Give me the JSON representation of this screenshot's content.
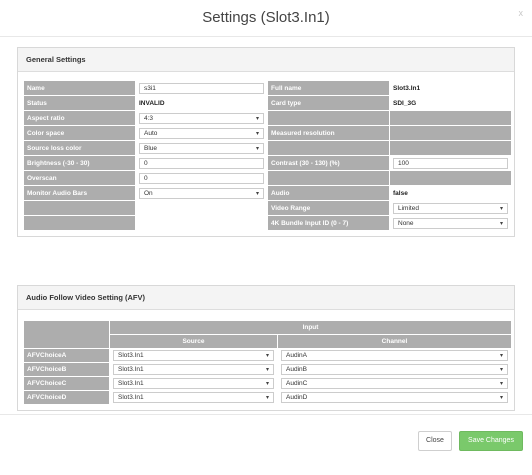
{
  "dialog": {
    "title": "Settings (Slot3.In1)",
    "close_glyph": "x"
  },
  "general": {
    "heading": "General Settings",
    "rows": [
      {
        "label": "Name",
        "value": "s3i1",
        "type": "input",
        "label2": "Full name",
        "value2": "Slot3.In1",
        "type2": "text"
      },
      {
        "label": "Status",
        "value": "INVALID",
        "type": "text",
        "label2": "Card type",
        "value2": "SDI_3G",
        "type2": "text"
      },
      {
        "label": "Aspect ratio",
        "value": "4:3",
        "type": "select",
        "label2": "",
        "value2": "",
        "type2": "none"
      },
      {
        "label": "Color space",
        "value": "Auto",
        "type": "select",
        "label2": "Measured resolution",
        "value2": "",
        "type2": "none"
      },
      {
        "label": "Source loss color",
        "value": "Blue",
        "type": "select",
        "label2": "",
        "value2": "",
        "type2": "none"
      },
      {
        "label": "Brightness (-30 - 30)",
        "value": "0",
        "type": "input",
        "label2": "Contrast (30 - 130) (%)",
        "value2": "100",
        "type2": "input"
      },
      {
        "label": "Overscan",
        "value": "0",
        "type": "input",
        "label2": "",
        "value2": "",
        "type2": "none"
      },
      {
        "label": "Monitor Audio Bars",
        "value": "On",
        "type": "select",
        "label2": "Audio",
        "value2": "false",
        "type2": "text"
      },
      {
        "label": "",
        "value": "",
        "type": "none",
        "label2": "Video Range",
        "value2": "Limited",
        "type2": "select"
      },
      {
        "label": "",
        "value": "",
        "type": "none",
        "label2": "4K Bundle Input ID (0 - 7)",
        "value2": "None",
        "type2": "select"
      }
    ]
  },
  "afv": {
    "heading": "Audio Follow Video Setting (AFV)",
    "input_header": "Input",
    "source_header": "Source",
    "channel_header": "Channel",
    "rows": [
      {
        "label": "AFVChoiceA",
        "source": "Slot3.In1",
        "channel": "AudinA"
      },
      {
        "label": "AFVChoiceB",
        "source": "Slot3.In1",
        "channel": "AudinB"
      },
      {
        "label": "AFVChoiceC",
        "source": "Slot3.In1",
        "channel": "AudinC"
      },
      {
        "label": "AFVChoiceD",
        "source": "Slot3.In1",
        "channel": "AudinD"
      }
    ]
  },
  "footer": {
    "close_label": "Close",
    "save_label": "Save Changes"
  },
  "colors": {
    "label_cell": "#adadad",
    "save_button": "#7ac96b"
  }
}
